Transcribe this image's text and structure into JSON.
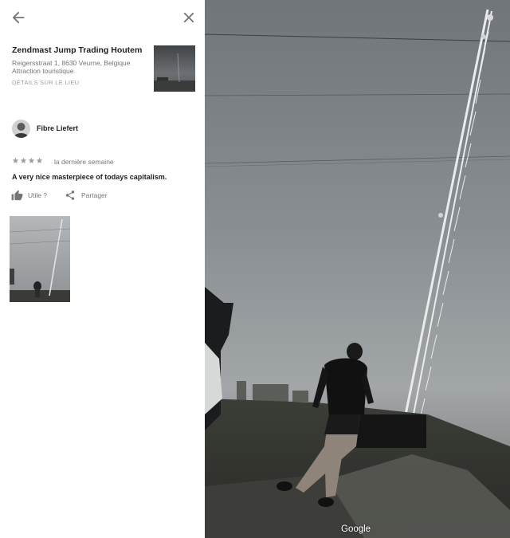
{
  "place": {
    "title": "Zendmast Jump Trading Houtem",
    "address": "Reigersstraat 1, 8630 Veurne, Belgique",
    "category": "Attraction touristique",
    "details_link": "DÉTAILS SUR LE LIEU"
  },
  "review": {
    "reviewer_name": "Fibre Liefert",
    "rating": 4,
    "rating_max": 5,
    "time": "la dernière semaine",
    "text": "A very nice masterpiece of todays capitalism.",
    "useful_label": "Utile ?",
    "share_label": "Partager"
  },
  "viewer": {
    "logo": "Google"
  },
  "icons": {
    "back": "arrow-back-icon",
    "close": "close-icon",
    "star": "star-icon",
    "useful": "thumb-up-icon",
    "share": "share-icon"
  },
  "colors": {
    "star": "#9e9e9e",
    "icon": "#757575",
    "secondary_text": "#757575"
  }
}
